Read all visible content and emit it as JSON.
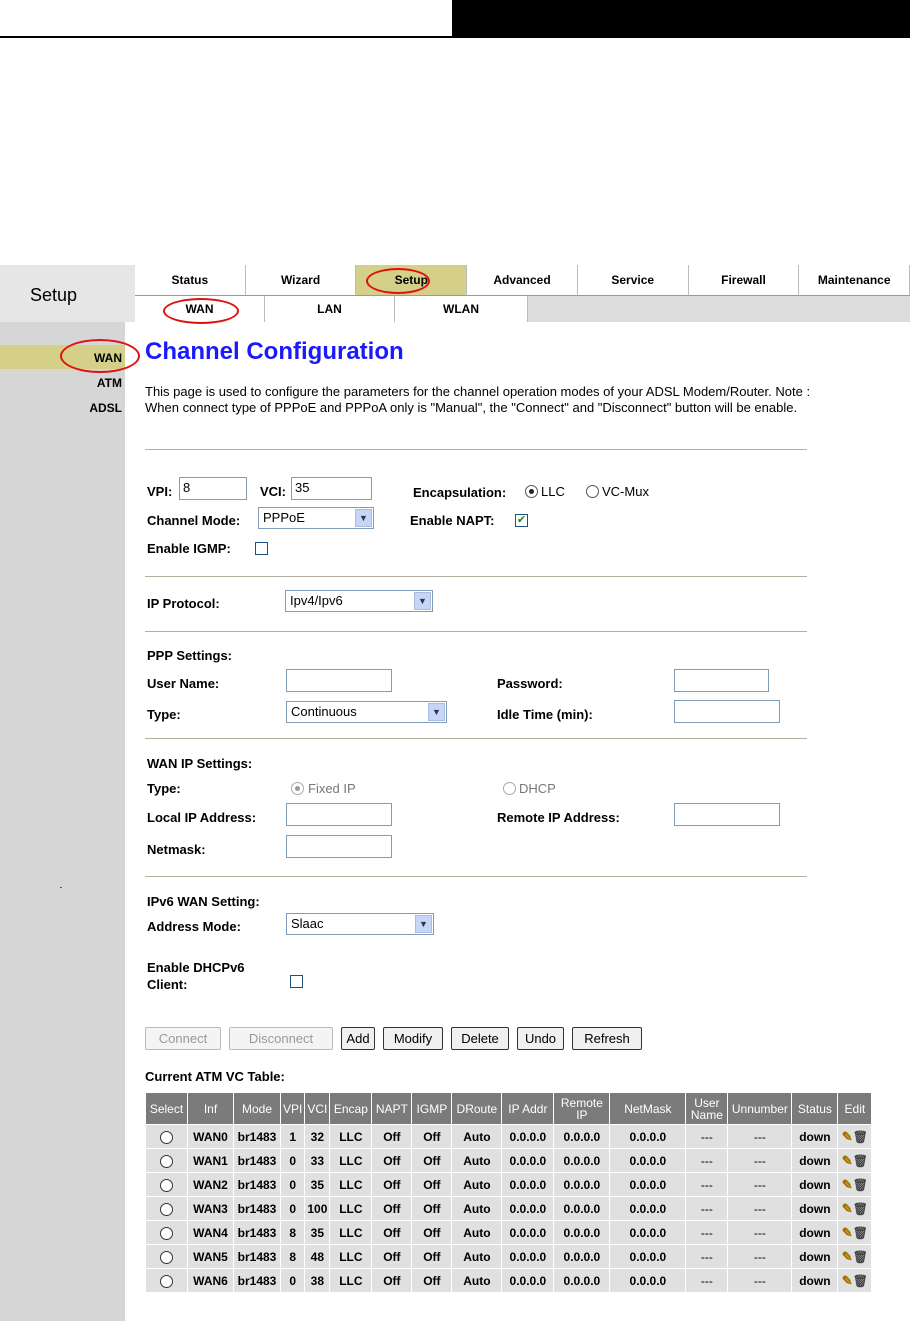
{
  "nav": {
    "section_title": "Setup",
    "main_tabs": [
      "Status",
      "Wizard",
      "Setup",
      "Advanced",
      "Service",
      "Firewall",
      "Maintenance"
    ],
    "sub_tabs": [
      "WAN",
      "LAN",
      "WLAN"
    ],
    "sidebar": [
      "WAN",
      "ATM",
      "ADSL"
    ]
  },
  "page": {
    "title": "Channel Configuration",
    "description": "This page is used to configure the parameters for the channel operation modes of your ADSL Modem/Router. Note : When connect type of PPPoE and PPPoA only is \"Manual\", the \"Connect\" and \"Disconnect\" button will be enable."
  },
  "form": {
    "vpi_label": "VPI:",
    "vpi": "8",
    "vci_label": "VCI:",
    "vci": "35",
    "encap_label": "Encapsulation:",
    "encap_llc": "LLC",
    "encap_vcmux": "VC-Mux",
    "channel_mode_label": "Channel Mode:",
    "channel_mode": "PPPoE",
    "napt_label": "Enable NAPT:",
    "igmp_label": "Enable IGMP:",
    "ip_protocol_label": "IP Protocol:",
    "ip_protocol": "Ipv4/Ipv6",
    "ppp_title": "PPP Settings:",
    "user_name_label": "User Name:",
    "password_label": "Password:",
    "type_label": "Type:",
    "ppp_type": "Continuous",
    "idle_label": "Idle Time (min):",
    "wanip_title": "WAN IP Settings:",
    "wan_type_label": "Type:",
    "fixed_ip": "Fixed IP",
    "dhcp": "DHCP",
    "local_ip_label": "Local IP Address:",
    "remote_ip_label": "Remote IP Address:",
    "netmask_label": "Netmask:",
    "ipv6_title": "IPv6 WAN Setting:",
    "address_mode_label": "Address Mode:",
    "address_mode": "Slaac",
    "dhcpv6_label_1": "Enable DHCPv6",
    "dhcpv6_label_2": "Client:"
  },
  "buttons": {
    "connect": "Connect",
    "disconnect": "Disconnect",
    "add": "Add",
    "modify": "Modify",
    "delete": "Delete",
    "undo": "Undo",
    "refresh": "Refresh"
  },
  "table": {
    "title": "Current ATM VC Table:",
    "headers": [
      "Select",
      "Inf",
      "Mode",
      "VPI",
      "VCI",
      "Encap",
      "NAPT",
      "IGMP",
      "DRoute",
      "IP Addr",
      "Remote IP",
      "NetMask",
      "User Name",
      "Unnumber",
      "Status",
      "Edit"
    ],
    "rows": [
      [
        "WAN0",
        "br1483",
        "1",
        "32",
        "LLC",
        "Off",
        "Off",
        "Auto",
        "0.0.0.0",
        "0.0.0.0",
        "0.0.0.0",
        "---",
        "---",
        "down"
      ],
      [
        "WAN1",
        "br1483",
        "0",
        "33",
        "LLC",
        "Off",
        "Off",
        "Auto",
        "0.0.0.0",
        "0.0.0.0",
        "0.0.0.0",
        "---",
        "---",
        "down"
      ],
      [
        "WAN2",
        "br1483",
        "0",
        "35",
        "LLC",
        "Off",
        "Off",
        "Auto",
        "0.0.0.0",
        "0.0.0.0",
        "0.0.0.0",
        "---",
        "---",
        "down"
      ],
      [
        "WAN3",
        "br1483",
        "0",
        "100",
        "LLC",
        "Off",
        "Off",
        "Auto",
        "0.0.0.0",
        "0.0.0.0",
        "0.0.0.0",
        "---",
        "---",
        "down"
      ],
      [
        "WAN4",
        "br1483",
        "8",
        "35",
        "LLC",
        "Off",
        "Off",
        "Auto",
        "0.0.0.0",
        "0.0.0.0",
        "0.0.0.0",
        "---",
        "---",
        "down"
      ],
      [
        "WAN5",
        "br1483",
        "8",
        "48",
        "LLC",
        "Off",
        "Off",
        "Auto",
        "0.0.0.0",
        "0.0.0.0",
        "0.0.0.0",
        "---",
        "---",
        "down"
      ],
      [
        "WAN6",
        "br1483",
        "0",
        "38",
        "LLC",
        "Off",
        "Off",
        "Auto",
        "0.0.0.0",
        "0.0.0.0",
        "0.0.0.0",
        "---",
        "---",
        "down"
      ]
    ]
  },
  "colors": {
    "title_blue": "#1a1aff",
    "active_tab": "#d4d08a",
    "highlight_circle": "#e01010",
    "table_header": "#7b7b7b"
  },
  "icons": {
    "edit": "pencil-icon",
    "delete": "trash-icon"
  }
}
